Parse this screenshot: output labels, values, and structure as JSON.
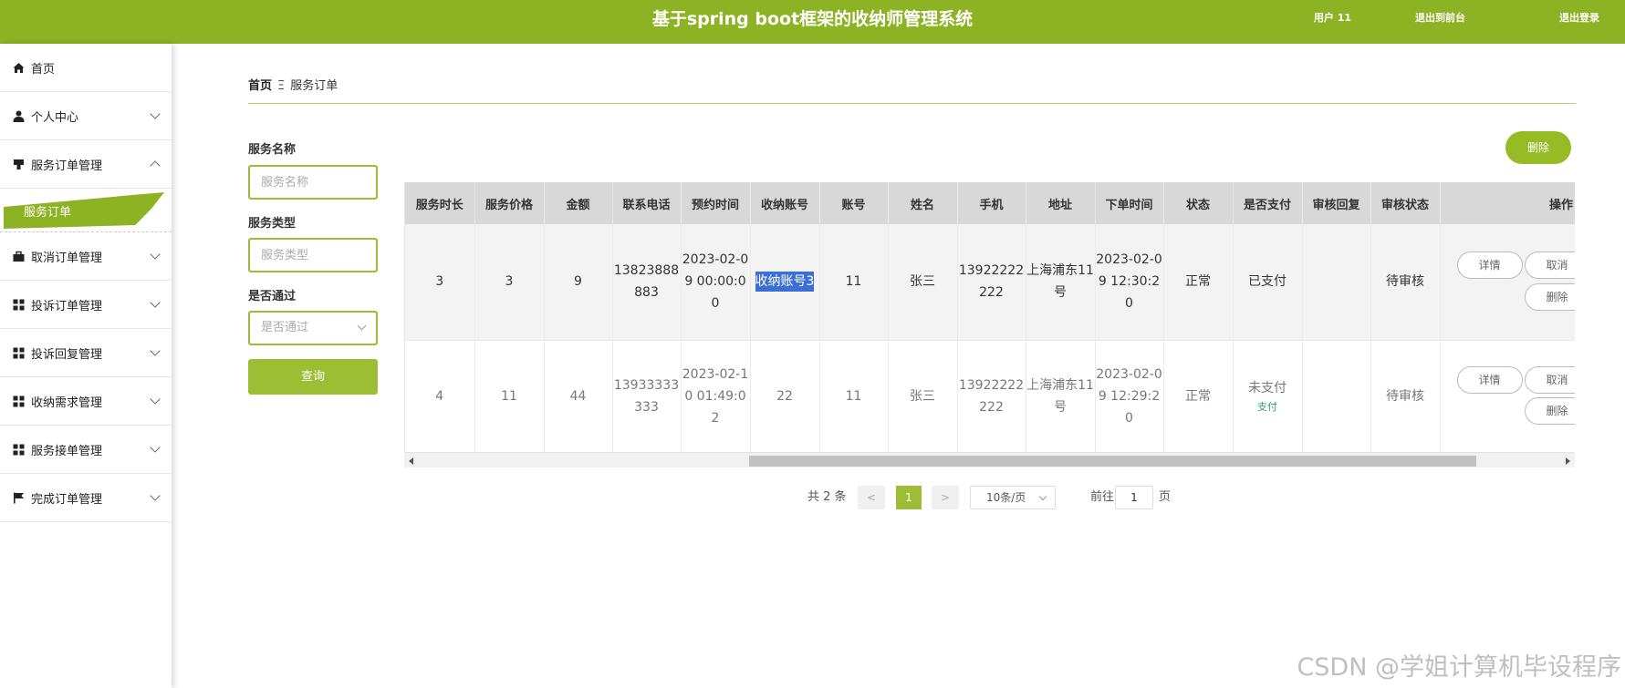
{
  "header": {
    "title": "基于spring boot框架的收纳师管理系统",
    "user_label": "用户 11",
    "back_label": "退出到前台",
    "logout_label": "退出登录"
  },
  "sidebar": {
    "items": [
      {
        "label": "首页",
        "icon": "home-icon"
      },
      {
        "label": "个人中心",
        "icon": "user-icon"
      },
      {
        "label": "服务订单管理",
        "icon": "service-icon",
        "expanded": true,
        "sub": "服务订单"
      },
      {
        "label": "取消订单管理",
        "icon": "briefcase-icon"
      },
      {
        "label": "投诉订单管理",
        "icon": "grid-icon"
      },
      {
        "label": "投诉回复管理",
        "icon": "grid-icon"
      },
      {
        "label": "收纳需求管理",
        "icon": "grid-icon"
      },
      {
        "label": "服务接单管理",
        "icon": "grid-icon"
      },
      {
        "label": "完成订单管理",
        "icon": "flag-icon"
      }
    ]
  },
  "breadcrumb": {
    "home": "首页",
    "separator": "Ξ",
    "current": "服务订单"
  },
  "search": {
    "name_label": "服务名称",
    "name_placeholder": "服务名称",
    "type_label": "服务类型",
    "type_placeholder": "服务类型",
    "pass_label": "是否通过",
    "pass_placeholder": "是否通过",
    "query_label": "查询"
  },
  "toolbar": {
    "delete_label": "删除"
  },
  "table": {
    "columns": [
      "服务时长",
      "服务价格",
      "金额",
      "联系电话",
      "预约时间",
      "收纳账号",
      "账号",
      "姓名",
      "手机",
      "地址",
      "下单时间",
      "状态",
      "是否支付",
      "审核回复",
      "审核状态",
      "操作"
    ],
    "rows": [
      {
        "duration": "3",
        "price": "3",
        "amount": "9",
        "phone": "13823888883",
        "appt_time": "2023-02-09 00:00:00",
        "organizer_account": "收纳账号3",
        "account": "11",
        "name": "张三",
        "mobile": "13922222222",
        "address": "上海浦东11号",
        "order_time": "2023-02-09 12:30:20",
        "status": "正常",
        "paid": "已支付",
        "reply": "",
        "review": "待审核",
        "btn_detail": "详情",
        "btn_2": "取消",
        "btn_3": "删除"
      },
      {
        "duration": "4",
        "price": "11",
        "amount": "44",
        "phone": "13933333333",
        "appt_time": "2023-02-10 01:49:02",
        "organizer_account": "22",
        "account": "11",
        "name": "张三",
        "mobile": "13922222222",
        "address": "上海浦东11号",
        "order_time": "2023-02-09 12:29:20",
        "status": "正常",
        "paid": "未支付",
        "pay_link": "支付",
        "reply": "",
        "review": "待审核",
        "btn_detail": "详情",
        "btn_2": "取消",
        "btn_3": "删除"
      }
    ]
  },
  "pagination": {
    "total": "共 2 条",
    "prev": "<",
    "current": "1",
    "next": ">",
    "page_size": "10条/页",
    "goto_prefix": "前往",
    "goto_value": "1",
    "goto_suffix": "页"
  },
  "watermark": "CSDN @学姐计算机毕设程序",
  "colors": {
    "brand": "#8db223",
    "accent": "#9dbd35",
    "selection": "#3c6fd6",
    "pay_link": "#2aa36b"
  }
}
